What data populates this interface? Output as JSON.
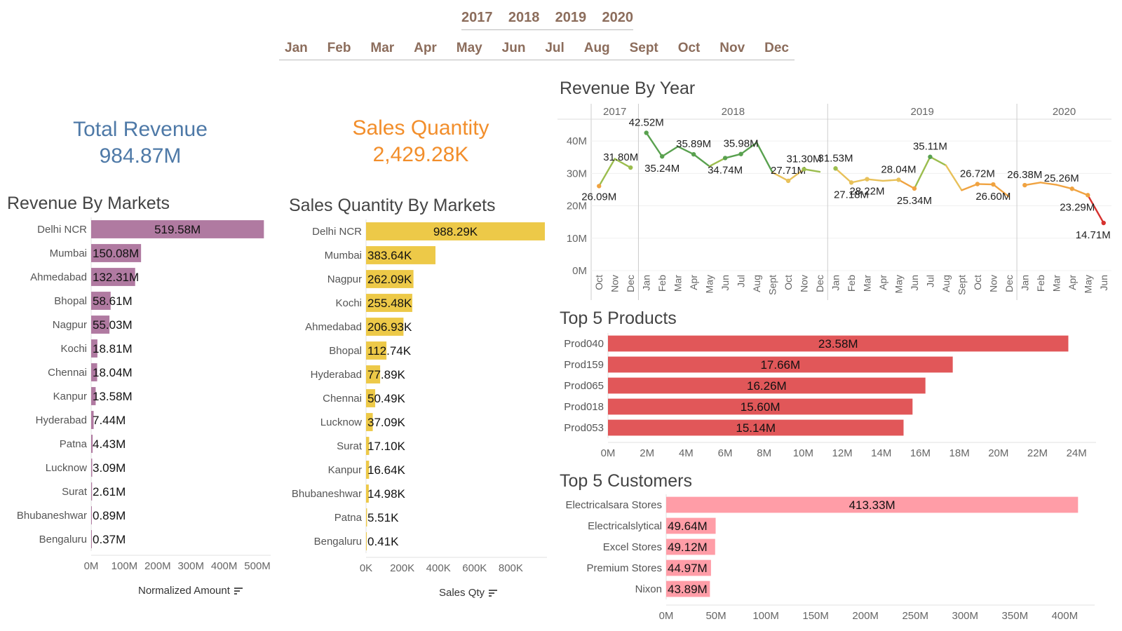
{
  "filters": {
    "years": [
      "2017",
      "2018",
      "2019",
      "2020"
    ],
    "months": [
      "Jan",
      "Feb",
      "Mar",
      "Apr",
      "May",
      "Jun",
      "Jul",
      "Aug",
      "Sept",
      "Oct",
      "Nov",
      "Dec"
    ]
  },
  "kpis": {
    "revenue": {
      "label": "Total Revenue",
      "value": "984.87M",
      "color": "#4e79a7"
    },
    "quantity": {
      "label": "Sales Quantity",
      "value": "2,429.28K",
      "color": "#f28e2b"
    }
  },
  "titles": {
    "rev_markets": "Revenue By Markets",
    "qty_markets": "Sales Quantity By Markets",
    "rev_year": "Revenue By Year",
    "top_products": "Top 5 Products",
    "top_customers": "Top 5 Customers"
  },
  "axis_titles": {
    "rev_markets": "Normalized Amount",
    "qty_markets": "Sales Qty"
  },
  "chart_data": [
    {
      "id": "rev_markets",
      "type": "bar",
      "orientation": "horizontal",
      "color": "#b07aa1",
      "categories": [
        "Delhi NCR",
        "Mumbai",
        "Ahmedabad",
        "Bhopal",
        "Nagpur",
        "Kochi",
        "Chennai",
        "Kanpur",
        "Hyderabad",
        "Patna",
        "Lucknow",
        "Surat",
        "Bhubaneshwar",
        "Bengaluru"
      ],
      "values": [
        519.58,
        150.08,
        132.31,
        58.61,
        55.03,
        18.81,
        18.04,
        13.58,
        7.44,
        4.43,
        3.09,
        2.61,
        0.89,
        0.37
      ],
      "labels": [
        "519.58M",
        "150.08M",
        "132.31M",
        "58.61M",
        "55.03M",
        "18.81M",
        "18.04M",
        "13.58M",
        "7.44M",
        "4.43M",
        "3.09M",
        "2.61M",
        "0.89M",
        "0.37M"
      ],
      "xlim": [
        0,
        540
      ],
      "ticks": [
        0,
        100,
        200,
        300,
        400,
        500
      ],
      "tick_labels": [
        "0M",
        "100M",
        "200M",
        "300M",
        "400M",
        "500M"
      ],
      "xlabel": "Normalized Amount"
    },
    {
      "id": "qty_markets",
      "type": "bar",
      "orientation": "horizontal",
      "color": "#edc948",
      "categories": [
        "Delhi NCR",
        "Mumbai",
        "Nagpur",
        "Kochi",
        "Ahmedabad",
        "Bhopal",
        "Hyderabad",
        "Chennai",
        "Lucknow",
        "Surat",
        "Kanpur",
        "Bhubaneshwar",
        "Patna",
        "Bengaluru"
      ],
      "values": [
        988.29,
        383.64,
        262.09,
        255.48,
        206.93,
        112.74,
        77.89,
        50.49,
        37.09,
        17.1,
        16.64,
        14.98,
        5.51,
        0.41
      ],
      "labels": [
        "988.29K",
        "383.64K",
        "262.09K",
        "255.48K",
        "206.93K",
        "112.74K",
        "77.89K",
        "50.49K",
        "37.09K",
        "17.10K",
        "16.64K",
        "14.98K",
        "5.51K",
        "0.41K"
      ],
      "xlim": [
        0,
        1000
      ],
      "ticks": [
        0,
        200,
        400,
        600,
        800
      ],
      "tick_labels": [
        "0K",
        "200K",
        "400K",
        "600K",
        "800K"
      ],
      "xlabel": "Sales Qty"
    },
    {
      "id": "rev_year",
      "type": "line",
      "ylim": [
        0,
        45
      ],
      "yticks": [
        0,
        10,
        20,
        30,
        40
      ],
      "ytick_labels": [
        "0M",
        "10M",
        "20M",
        "30M",
        "40M"
      ],
      "panels": [
        {
          "year": "2017",
          "months": [
            "Oct",
            "Nov",
            "Dec"
          ],
          "values": [
            26.09,
            34.5,
            31.8
          ]
        },
        {
          "year": "2018",
          "months": [
            "Jan",
            "Feb",
            "Mar",
            "Apr",
            "May",
            "Jun",
            "Jul",
            "Aug",
            "Sept",
            "Oct",
            "Nov",
            "Dec"
          ],
          "values": [
            42.52,
            35.24,
            38.3,
            35.89,
            32.2,
            34.74,
            35.98,
            39.5,
            30.3,
            27.71,
            31.3,
            30.5
          ]
        },
        {
          "year": "2019",
          "months": [
            "Jan",
            "Feb",
            "Mar",
            "Apr",
            "May",
            "Jun",
            "Jul",
            "Aug",
            "Sept",
            "Oct",
            "Nov",
            "Dec"
          ],
          "values": [
            31.53,
            27.18,
            28.22,
            27.7,
            28.04,
            25.34,
            35.11,
            32.5,
            24.8,
            26.72,
            26.6,
            22.8
          ]
        },
        {
          "year": "2020",
          "months": [
            "Jan",
            "Feb",
            "Mar",
            "Apr",
            "May",
            "Jun"
          ],
          "values": [
            26.38,
            27.2,
            26.5,
            25.26,
            23.29,
            14.71
          ]
        }
      ],
      "point_labels": [
        {
          "panel": 0,
          "index": 0,
          "text": "26.09M"
        },
        {
          "panel": 0,
          "index": 2,
          "text": "31.80M"
        },
        {
          "panel": 1,
          "index": 0,
          "text": "42.52M"
        },
        {
          "panel": 1,
          "index": 1,
          "text": "35.24M"
        },
        {
          "panel": 1,
          "index": 3,
          "text": "35.89M"
        },
        {
          "panel": 1,
          "index": 5,
          "text": "34.74M"
        },
        {
          "panel": 1,
          "index": 6,
          "text": "35.98M"
        },
        {
          "panel": 1,
          "index": 9,
          "text": "27.71M"
        },
        {
          "panel": 1,
          "index": 10,
          "text": "31.30M"
        },
        {
          "panel": 2,
          "index": 0,
          "text": "31.53M"
        },
        {
          "panel": 2,
          "index": 1,
          "text": "27.18M"
        },
        {
          "panel": 2,
          "index": 2,
          "text": "28.22M"
        },
        {
          "panel": 2,
          "index": 4,
          "text": "28.04M"
        },
        {
          "panel": 2,
          "index": 5,
          "text": "25.34M"
        },
        {
          "panel": 2,
          "index": 6,
          "text": "35.11M"
        },
        {
          "panel": 2,
          "index": 9,
          "text": "26.72M"
        },
        {
          "panel": 2,
          "index": 10,
          "text": "26.60M"
        },
        {
          "panel": 3,
          "index": 0,
          "text": "26.38M"
        },
        {
          "panel": 3,
          "index": 3,
          "text": "25.26M"
        },
        {
          "panel": 3,
          "index": 4,
          "text": "23.29M"
        },
        {
          "panel": 3,
          "index": 5,
          "text": "14.71M"
        }
      ]
    },
    {
      "id": "top_products",
      "type": "bar",
      "orientation": "horizontal",
      "color": "#e15759",
      "categories": [
        "Prod040",
        "Prod159",
        "Prod065",
        "Prod018",
        "Prod053"
      ],
      "values": [
        23.58,
        17.66,
        16.26,
        15.6,
        15.14
      ],
      "labels": [
        "23.58M",
        "17.66M",
        "16.26M",
        "15.60M",
        "15.14M"
      ],
      "xlim": [
        0,
        25
      ],
      "ticks": [
        0,
        2,
        4,
        6,
        8,
        10,
        12,
        14,
        16,
        18,
        20,
        22,
        24
      ],
      "tick_labels": [
        "0M",
        "2M",
        "4M",
        "6M",
        "8M",
        "10M",
        "12M",
        "14M",
        "16M",
        "18M",
        "20M",
        "22M",
        "24M"
      ]
    },
    {
      "id": "top_customers",
      "type": "bar",
      "orientation": "horizontal",
      "color": "#ff9da7",
      "categories": [
        "Electricalsara Stores",
        "Electricalslytical",
        "Excel Stores",
        "Premium Stores",
        "Nixon"
      ],
      "values": [
        413.33,
        49.64,
        49.12,
        44.97,
        43.89
      ],
      "labels": [
        "413.33M",
        "49.64M",
        "49.12M",
        "44.97M",
        "43.89M"
      ],
      "xlim": [
        0,
        430
      ],
      "ticks": [
        0,
        50,
        100,
        150,
        200,
        250,
        300,
        350,
        400
      ],
      "tick_labels": [
        "0M",
        "50M",
        "100M",
        "150M",
        "200M",
        "250M",
        "300M",
        "350M",
        "400M"
      ]
    }
  ]
}
